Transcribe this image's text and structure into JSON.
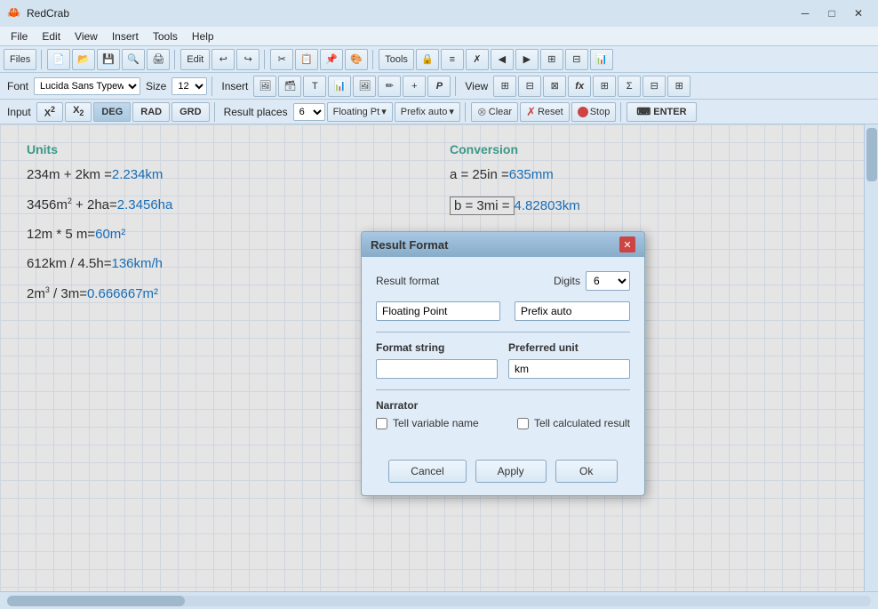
{
  "app": {
    "title": "RedCrab",
    "icon": "🦀"
  },
  "window_controls": {
    "minimize": "─",
    "maximize": "□",
    "close": "✕"
  },
  "menu": {
    "items": [
      "File",
      "Edit",
      "View",
      "Insert",
      "Tools",
      "Help"
    ]
  },
  "toolbar1": {
    "files_label": "Files",
    "edit_label": "Edit",
    "tools_label": "Tools"
  },
  "toolbar2": {
    "font_label": "Font",
    "font_value": "Lucida Sans Typewr...",
    "size_label": "Size",
    "size_value": "12",
    "insert_label": "Insert",
    "view_label": "View"
  },
  "input_toolbar": {
    "input_label": "Input",
    "x2_label": "X²",
    "x2sub_label": "X₂",
    "deg_label": "DEG",
    "rad_label": "RAD",
    "grd_label": "GRD",
    "result_places_label": "Result places",
    "result_places_value": "6",
    "floating_label": "Floating Pt",
    "prefix_label": "Prefix auto",
    "clear_label": "Clear",
    "reset_label": "Reset",
    "stop_label": "Stop",
    "enter_label": "ENTER"
  },
  "content": {
    "units_title": "Units",
    "conversion_title": "Conversion",
    "lines": [
      {
        "left": "234m + 2km =",
        "left_result": "2.234km",
        "right": "a = 25in =",
        "right_result": "635mm"
      },
      {
        "left": "3456m² + 2ha=",
        "left_result": "2.3456ha",
        "right_box": "b = 3mi =",
        "right_result": "4.82803km"
      },
      {
        "left": "12m * 5 m=",
        "left_result": "60m²"
      },
      {
        "left": "612km / 4.5h=",
        "left_result": "136km/h"
      },
      {
        "left": "2m³ / 3m=",
        "left_result": "0.666667m²"
      }
    ]
  },
  "dialog": {
    "title": "Result Format",
    "close_btn": "✕",
    "result_format_label": "Result format",
    "digits_label": "Digits",
    "digits_value": "6",
    "format_value": "Floating Point",
    "prefix_value": "Prefix auto",
    "format_string_label": "Format string",
    "format_string_value": "",
    "preferred_unit_label": "Preferred unit",
    "preferred_unit_value": "km",
    "narrator_label": "Narrator",
    "tell_variable_label": "Tell variable name",
    "tell_result_label": "Tell calculated result",
    "cancel_btn": "Cancel",
    "apply_btn": "Apply",
    "ok_btn": "Ok"
  }
}
